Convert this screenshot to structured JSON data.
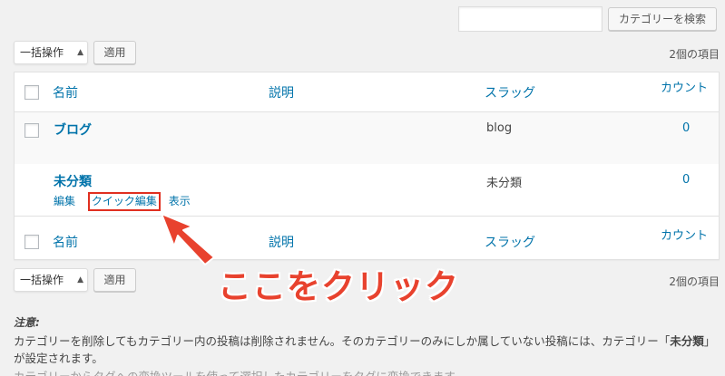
{
  "search": {
    "value": "",
    "button_label": "カテゴリーを検索"
  },
  "bulk_actions": {
    "top_label": "一括操作",
    "bottom_label": "一括操作",
    "apply_label": "適用"
  },
  "item_count": "2個の項目",
  "table": {
    "columns": {
      "name": "名前",
      "description": "説明",
      "slug": "スラッグ",
      "count": "カウント"
    },
    "rows": [
      {
        "name": "ブログ",
        "slug": "blog",
        "count": "0"
      },
      {
        "name": "未分類",
        "slug": "未分類",
        "count": "0",
        "actions": {
          "edit": "編集",
          "quick_edit": "クイック編集",
          "view": "表示"
        }
      }
    ]
  },
  "callout": "ここをクリック",
  "colors": {
    "link": "#0073aa",
    "highlight": "#e02f20",
    "callout": "#e8422e"
  },
  "note": {
    "title": "注意:",
    "text_a": "カテゴリーを削除してもカテゴリー内の投稿は削除されません。そのカテゴリーのみにしか属していない投稿には、カテゴリー「",
    "text_b": "未分類",
    "text_c": "」が設定されます。",
    "cut_line": "カテゴリーからタグへの変換ツールを使って選択したカテゴリーをタグに変換できます。"
  }
}
